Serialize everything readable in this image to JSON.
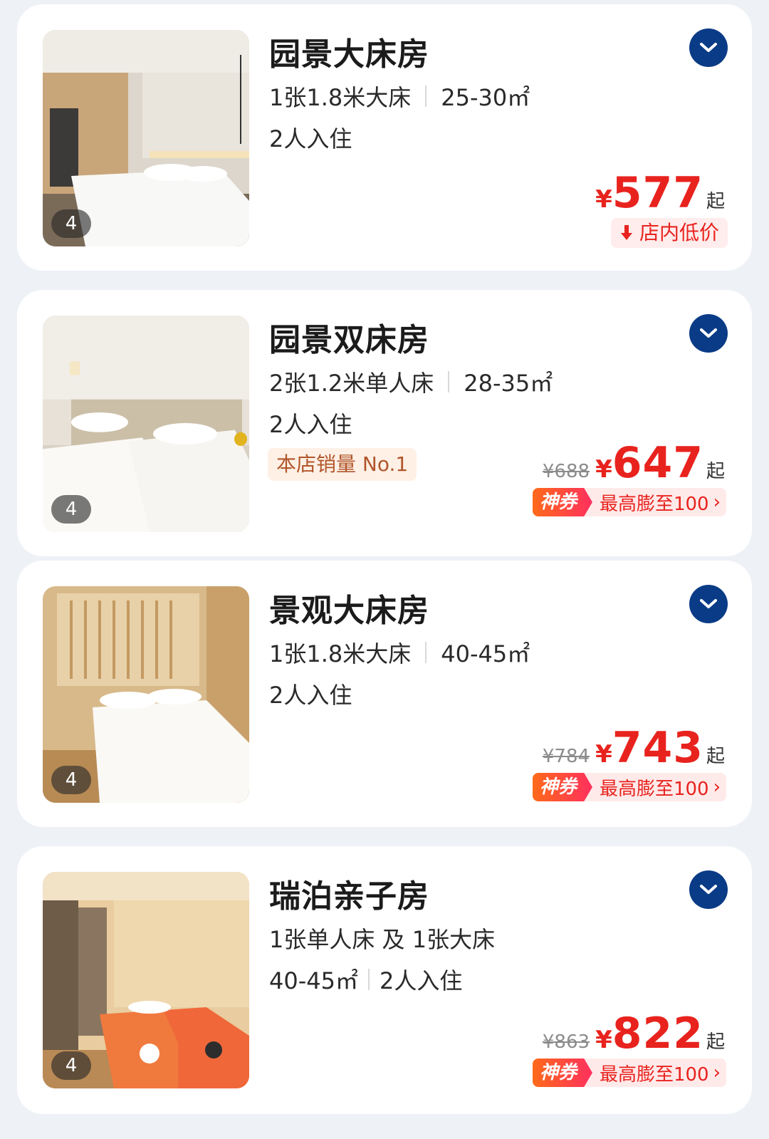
{
  "rooms": [
    {
      "name": "园景大床房",
      "bed": "1张1.8米大床",
      "area": "25-30㎡",
      "occupancy": "2人入住",
      "photo_count": "4",
      "currency": "¥",
      "price": "577",
      "price_suffix": "起",
      "badge": "店内低价"
    },
    {
      "name": "园景双床房",
      "bed": "2张1.2米单人床",
      "area": "28-35㎡",
      "occupancy": "2人入住",
      "photo_count": "4",
      "sales_tag": "本店销量 No.1",
      "original_price": "¥688",
      "currency": "¥",
      "price": "647",
      "price_suffix": "起",
      "coupon_label": "神券",
      "coupon_text": "最高膨至100",
      "coupon_arrow": "›"
    },
    {
      "name": "景观大床房",
      "bed": "1张1.8米大床",
      "area": "40-45㎡",
      "occupancy": "2人入住",
      "photo_count": "4",
      "original_price": "¥784",
      "currency": "¥",
      "price": "743",
      "price_suffix": "起",
      "coupon_label": "神券",
      "coupon_text": "最高膨至100",
      "coupon_arrow": "›"
    },
    {
      "name": "瑞泊亲子房",
      "bed": "1张单人床 及 1张大床",
      "area": "40-45㎡",
      "occupancy": "2人入住",
      "photo_count": "4",
      "original_price": "¥863",
      "currency": "¥",
      "price": "822",
      "price_suffix": "起",
      "coupon_label": "神券",
      "coupon_text": "最高膨至100",
      "coupon_arrow": "›"
    }
  ],
  "icons": {
    "expand": "chevron-down-icon",
    "low_price": "arrow-down-icon"
  },
  "colors": {
    "price_red": "#e8231e",
    "expand_blue": "#0a3b86",
    "page_bg": "#eef1f6"
  }
}
